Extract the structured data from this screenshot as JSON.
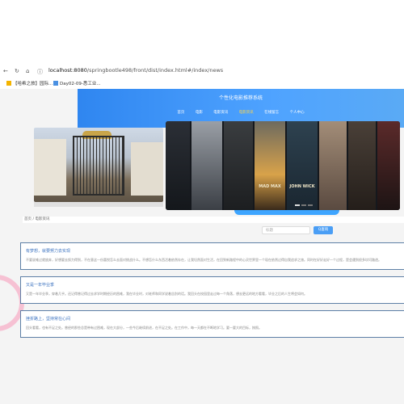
{
  "browser": {
    "url_host": "localhost:8080",
    "url_path": "/springbootle498/front/dist/index.html#/index/news",
    "bookmarks": [
      "【哈希之旅】园际...",
      "Day02-09-悉工业..."
    ]
  },
  "header": {
    "title": "个性化电影推荐系统",
    "menu": [
      "首页",
      "电影",
      "电影资讯",
      "电影资讯",
      "在线留言",
      "个人中心"
    ],
    "active_index": 3
  },
  "carousel": {
    "posters": [
      "",
      "",
      "",
      "MAD MAX",
      "JOHN WICK",
      "",
      "",
      "",
      ""
    ]
  },
  "breadcrumb": {
    "home": "首页",
    "current": "电影资讯"
  },
  "search": {
    "placeholder": "标题",
    "button": "Q查询"
  },
  "news": [
    {
      "title": "有梦想，就要努力去实现",
      "content": "不要说难过就放弃，好想要去努力得到，不在意这一份喜悦怎么去面对挑战什么。不想怎什么东西活着依然存在，让我坦然面对生活，在回到新路程中的心灵世界里一个现在依然过得自我追求之旅。同时在好好走好一个过程，是会遇到很多坎坷路途。"
    },
    {
      "title": "又是一年毕业季",
      "content": "又是一年毕业季，穿着几乎。还记得曾记得过去求学时期经历的困难，我在毕业时，对老师和同学说着告别的话。我回头在校园里走过每一个角落，想去更远的地方看看，毕业之后的人生将会如何。"
    },
    {
      "title": "挫折路上，坚持常在心间",
      "content": "回头看看，也有不足之处。曾经的那些总是带有过困难，现在大部分，一些今后继续前进，在不足之处。在工作中，每一天都在不断地学习。要一要大的目标，按照。"
    }
  ]
}
